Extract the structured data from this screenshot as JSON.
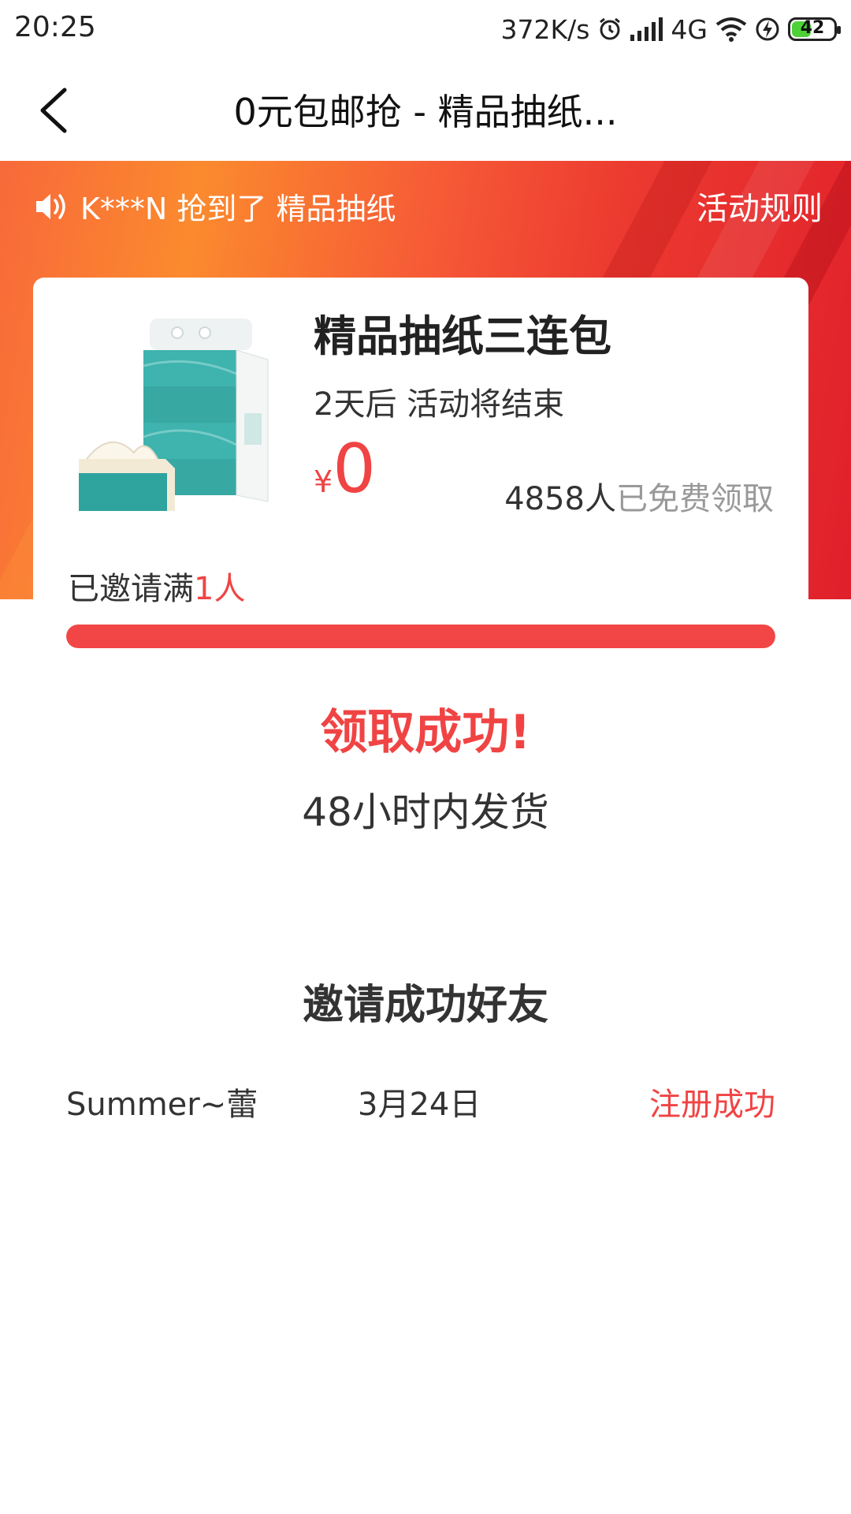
{
  "status_bar": {
    "time": "20:25",
    "net_speed": "372K/s",
    "network": "4G",
    "battery": "42",
    "icons": [
      "alarm-icon",
      "signal-icon",
      "wifi-icon",
      "charging-icon",
      "battery-icon"
    ]
  },
  "nav": {
    "title": "0元包邮抢 - 精品抽纸...",
    "back_icon": "chevron-left-icon"
  },
  "banner": {
    "ticker_text": "K***N 抢到了 精品抽纸",
    "rules_label": "活动规则",
    "colors": {
      "start": "#f8693a",
      "mid": "#fb8a2e",
      "end": "#e0202b"
    }
  },
  "product": {
    "title": "精品抽纸三连包",
    "countdown": "2天后 活动将结束",
    "price_symbol": "¥",
    "price": "0",
    "claimed_count": "4858人",
    "claimed_label": "已免费领取",
    "invite_prefix": "已邀请满",
    "invite_count": "1人"
  },
  "progress": {
    "percent": 100
  },
  "result": {
    "title": "领取成功!",
    "note": "48小时内发货"
  },
  "friends": {
    "title": "邀请成功好友",
    "rows": [
      {
        "name": "Summer~蕾",
        "date": "3月24日",
        "status": "注册成功"
      }
    ]
  },
  "colors": {
    "accent": "#f04444",
    "text": "#333333",
    "muted": "#999999"
  }
}
